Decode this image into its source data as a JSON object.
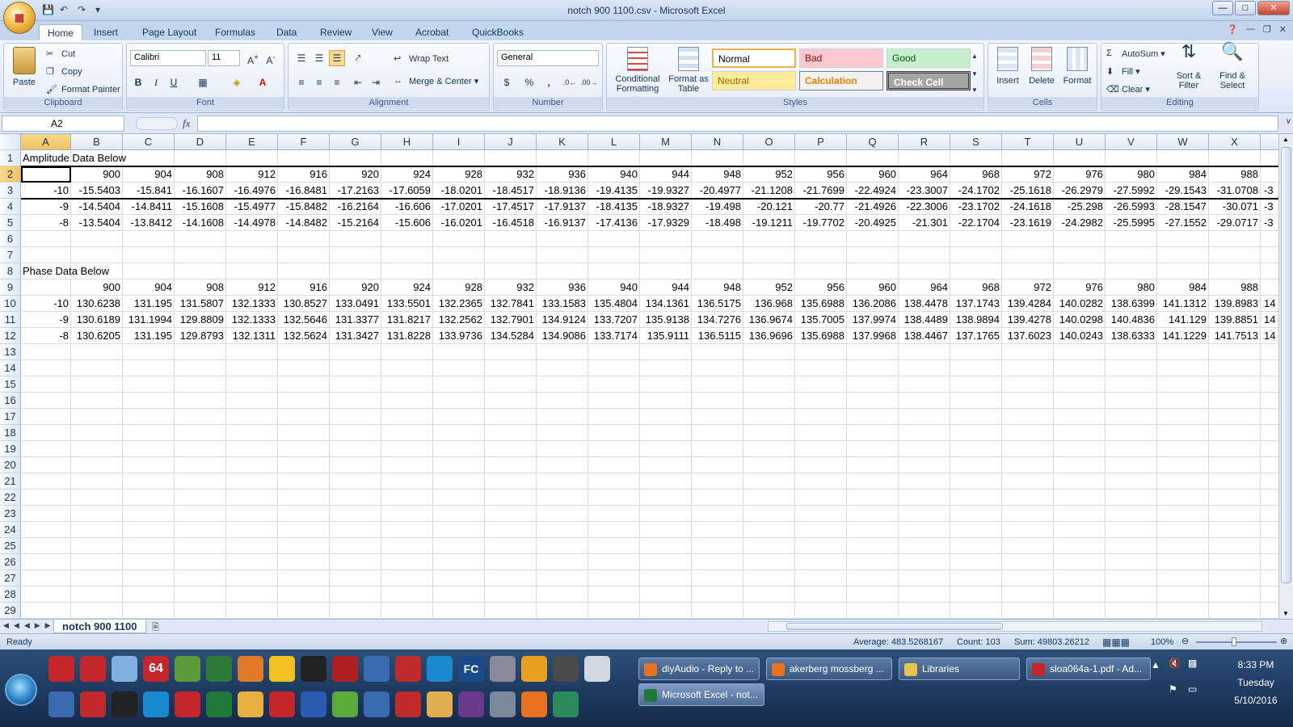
{
  "window": {
    "title": "notch 900 1100.csv - Microsoft Excel",
    "office_button": "Office"
  },
  "tabs": [
    "Home",
    "Insert",
    "Page Layout",
    "Formulas",
    "Data",
    "Review",
    "View",
    "Acrobat",
    "QuickBooks"
  ],
  "ribbon": {
    "clipboard": {
      "label": "Clipboard",
      "paste": "Paste",
      "cut": "Cut",
      "copy": "Copy",
      "format_painter": "Format Painter"
    },
    "font": {
      "label": "Font",
      "name": "Calibri",
      "size": "11",
      "bold": "B",
      "italic": "I",
      "underline": "U"
    },
    "alignment": {
      "label": "Alignment",
      "wrap_text": "Wrap Text",
      "merge_center": "Merge & Center"
    },
    "number": {
      "label": "Number",
      "format": "General",
      "currency": "$",
      "percent": "%",
      "comma": ","
    },
    "styles": {
      "label": "Styles",
      "conditional": "Conditional Formatting",
      "format_table": "Format as Table",
      "normal": "Normal",
      "bad": "Bad",
      "good": "Good",
      "neutral": "Neutral",
      "calculation": "Calculation",
      "check_cell": "Check Cell"
    },
    "cells": {
      "label": "Cells",
      "insert": "Insert",
      "delete": "Delete",
      "format": "Format"
    },
    "editing": {
      "label": "Editing",
      "autosum": "AutoSum",
      "fill": "Fill",
      "clear": "Clear",
      "sort_filter": "Sort & Filter",
      "find_select": "Find & Select"
    }
  },
  "formula_bar": {
    "name_box": "A2",
    "fx": "fx",
    "value": ""
  },
  "grid": {
    "columns": [
      "A",
      "B",
      "C",
      "D",
      "E",
      "F",
      "G",
      "H",
      "I",
      "J",
      "K",
      "L",
      "M",
      "N",
      "O",
      "P",
      "Q",
      "R",
      "S",
      "T",
      "U",
      "V",
      "W",
      "X"
    ],
    "row_numbers": [
      "1",
      "2",
      "3",
      "4",
      "5",
      "6",
      "7",
      "8",
      "9",
      "10",
      "11",
      "12",
      "13",
      "14",
      "15",
      "16",
      "17",
      "18",
      "19",
      "20",
      "21",
      "22",
      "23",
      "24",
      "25",
      "26",
      "27",
      "28",
      "29"
    ],
    "rows": {
      "1": {
        "A": "Amplitude Data Below"
      },
      "2": {
        "cells": [
          "",
          "900",
          "904",
          "908",
          "912",
          "916",
          "920",
          "924",
          "928",
          "932",
          "936",
          "940",
          "944",
          "948",
          "952",
          "956",
          "960",
          "964",
          "968",
          "972",
          "976",
          "980",
          "984",
          "988"
        ]
      },
      "3": {
        "cells": [
          "-10",
          "-15.5403",
          "-15.841",
          "-16.1607",
          "-16.4976",
          "-16.8481",
          "-17.2163",
          "-17.6059",
          "-18.0201",
          "-18.4517",
          "-18.9136",
          "-19.4135",
          "-19.9327",
          "-20.4977",
          "-21.1208",
          "-21.7699",
          "-22.4924",
          "-23.3007",
          "-24.1702",
          "-25.1618",
          "-26.2979",
          "-27.5992",
          "-29.1543",
          "-31.0708"
        ]
      },
      "4": {
        "cells": [
          "-9",
          "-14.5404",
          "-14.8411",
          "-15.1608",
          "-15.4977",
          "-15.8482",
          "-16.2164",
          "-16.606",
          "-17.0201",
          "-17.4517",
          "-17.9137",
          "-18.4135",
          "-18.9327",
          "-19.498",
          "-20.121",
          "-20.77",
          "-21.4926",
          "-22.3006",
          "-23.1702",
          "-24.1618",
          "-25.298",
          "-26.5993",
          "-28.1547",
          "-30.071"
        ]
      },
      "5": {
        "cells": [
          "-8",
          "-13.5404",
          "-13.8412",
          "-14.1608",
          "-14.4978",
          "-14.8482",
          "-15.2164",
          "-15.606",
          "-16.0201",
          "-16.4518",
          "-16.9137",
          "-17.4136",
          "-17.9329",
          "-18.498",
          "-19.1211",
          "-19.7702",
          "-20.4925",
          "-21.301",
          "-22.1704",
          "-23.1619",
          "-24.2982",
          "-25.5995",
          "-27.1552",
          "-29.0717"
        ]
      },
      "8": {
        "A": "Phase Data Below"
      },
      "9": {
        "cells": [
          "",
          "900",
          "904",
          "908",
          "912",
          "916",
          "920",
          "924",
          "928",
          "932",
          "936",
          "940",
          "944",
          "948",
          "952",
          "956",
          "960",
          "964",
          "968",
          "972",
          "976",
          "980",
          "984",
          "988"
        ]
      },
      "10": {
        "cells": [
          "-10",
          "130.6238",
          "131.195",
          "131.5807",
          "132.1333",
          "130.8527",
          "133.0491",
          "133.5501",
          "132.2365",
          "132.7841",
          "133.1583",
          "135.4804",
          "134.1361",
          "136.5175",
          "136.968",
          "135.6988",
          "136.2086",
          "138.4478",
          "137.1743",
          "139.4284",
          "140.0282",
          "138.6399",
          "141.1312",
          "139.8983"
        ]
      },
      "11": {
        "cells": [
          "-9",
          "130.6189",
          "131.1994",
          "129.8809",
          "132.1333",
          "132.5646",
          "131.3377",
          "131.8217",
          "132.2562",
          "132.7901",
          "134.9124",
          "133.7207",
          "135.9138",
          "134.7276",
          "136.9674",
          "135.7005",
          "137.9974",
          "138.4489",
          "138.9894",
          "139.4278",
          "140.0298",
          "140.4836",
          "141.129",
          "139.8851"
        ]
      },
      "12": {
        "cells": [
          "-8",
          "130.6205",
          "131.195",
          "129.8793",
          "132.1311",
          "132.5624",
          "131.3427",
          "131.8228",
          "133.9736",
          "134.5284",
          "134.9086",
          "133.7174",
          "135.9111",
          "136.5115",
          "136.9696",
          "135.6988",
          "137.9968",
          "138.4467",
          "137.1765",
          "137.6023",
          "140.0243",
          "138.6333",
          "141.1229",
          "141.7513"
        ]
      }
    },
    "overflow_text": {
      "3": "-3",
      "4": "-3",
      "5": "-3",
      "10": "14",
      "11": "14",
      "12": "14"
    }
  },
  "sheet_tab": "notch 900 1100",
  "status": {
    "ready": "Ready",
    "average": "Average: 483.5268167",
    "count": "Count: 103",
    "sum": "Sum: 49803.26212",
    "zoom": "100%"
  },
  "taskbar": {
    "windows": [
      "diyAudio - Reply to ...",
      "akerberg mossberg ...",
      "Libraries",
      "sloa064a-1.pdf - Ad...",
      "Microsoft Excel - not..."
    ],
    "clock_time": "8:33 PM",
    "clock_day": "Tuesday",
    "clock_date": "5/10/2016",
    "icon_64": "64",
    "icon_fc": "FC"
  },
  "colors": {
    "ribbon_blue": "#c3d6ee",
    "selection_orange": "#f1c15f",
    "bad_bg": "#ffc7ce",
    "good_bg": "#c6efce",
    "neutral_bg": "#ffeb9c",
    "taskbar": "#13294a"
  }
}
